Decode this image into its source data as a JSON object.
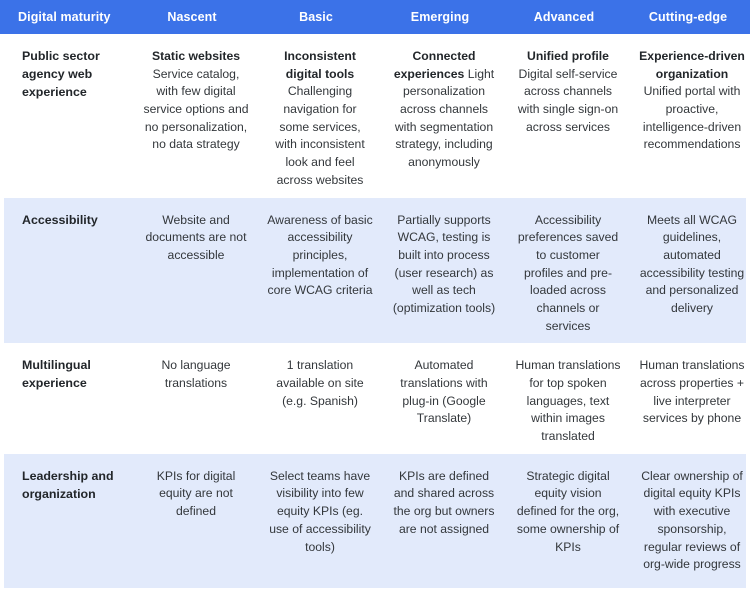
{
  "table": {
    "accent_color": "#3b72e8",
    "shaded_row_color": "#e2eafb",
    "background_color": "#ffffff",
    "text_color": "#33373b",
    "headers": [
      "Digital maturity",
      "Nascent",
      "Basic",
      "Emerging",
      "Advanced",
      "Cutting-edge"
    ],
    "rows": [
      {
        "label": "Public sector agency web experience",
        "shaded": false,
        "cells": [
          {
            "lead": "Static websites",
            "body": "Service catalog, with few digital service options and no personalization, no data strategy"
          },
          {
            "lead": "Inconsistent digital tools",
            "body": "Challenging navigation for some services, with inconsistent look and feel across websites"
          },
          {
            "lead": "Connected experiences",
            "body": "Light personalization across channels with segmentation strategy, including anonymously"
          },
          {
            "lead": "Unified profile",
            "body": "Digital self-service across channels with single sign-on across services"
          },
          {
            "lead": "Experience-driven organization",
            "body": "Unified portal with proactive, intelligence-driven recommendations"
          }
        ]
      },
      {
        "label": "Accessibility",
        "shaded": true,
        "cells": [
          {
            "lead": "",
            "body": "Website and documents are not accessible"
          },
          {
            "lead": "",
            "body": "Awareness of basic accessibility principles, implementation of core WCAG criteria"
          },
          {
            "lead": "",
            "body": "Partially supports WCAG, testing is built into process (user research) as well as tech (optimization tools)"
          },
          {
            "lead": "",
            "body": "Accessibility preferences saved to customer profiles and pre-loaded across channels or services"
          },
          {
            "lead": "",
            "body": "Meets all WCAG guidelines, automated accessibility testing and personalized delivery"
          }
        ]
      },
      {
        "label": "Multilingual experience",
        "shaded": false,
        "cells": [
          {
            "lead": "",
            "body": "No language translations"
          },
          {
            "lead": "",
            "body": "1 translation available on site (e.g. Spanish)"
          },
          {
            "lead": "",
            "body": "Automated translations with plug-in (Google Translate)"
          },
          {
            "lead": "",
            "body": "Human translations for top spoken languages, text within images translated"
          },
          {
            "lead": "",
            "body": "Human translations across properties + live interpreter services by phone"
          }
        ]
      },
      {
        "label": "Leadership and organization",
        "shaded": true,
        "cells": [
          {
            "lead": "",
            "body": "KPIs for digital equity are not defined"
          },
          {
            "lead": "",
            "body": "Select teams have visibility into few equity KPIs (eg. use of accessibility tools)"
          },
          {
            "lead": "",
            "body": "KPIs are defined and shared across the org but owners are not assigned"
          },
          {
            "lead": "",
            "body": "Strategic digital equity vision defined for the org, some ownership of KPIs"
          },
          {
            "lead": "",
            "body": "Clear ownership of digital equity KPIs with executive sponsorship, regular reviews of org-wide progress"
          }
        ]
      }
    ]
  }
}
